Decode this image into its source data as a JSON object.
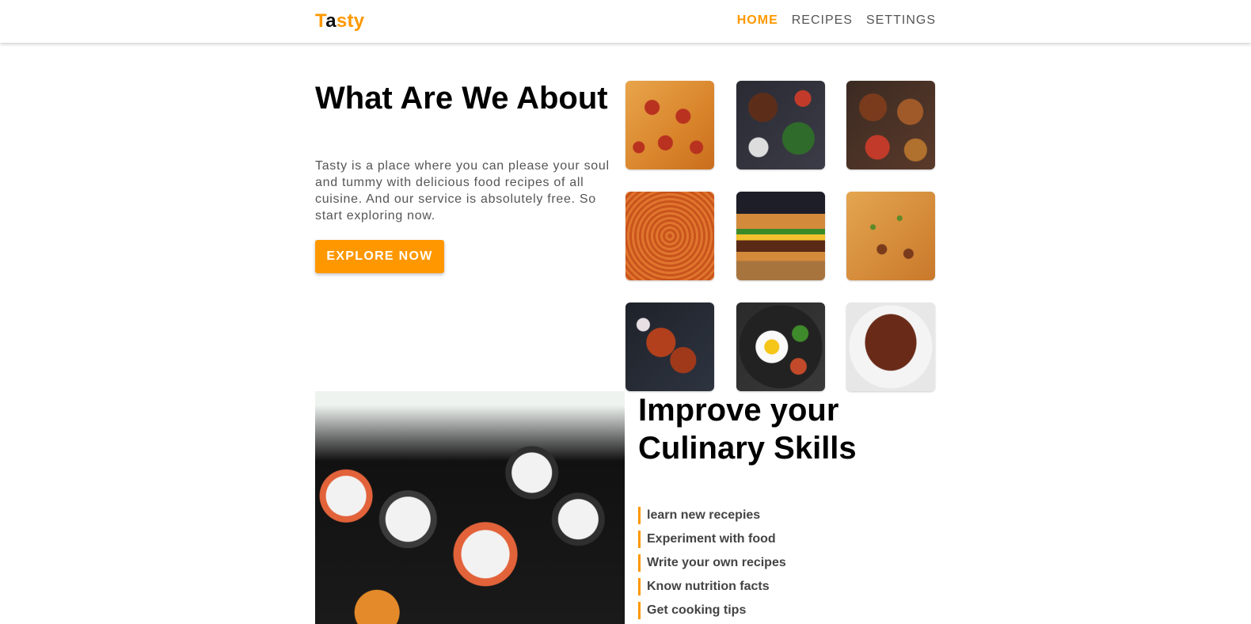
{
  "brand": {
    "logo_t": "T",
    "logo_a": "a",
    "logo_rest": "sty",
    "accent_color": "#ff9800"
  },
  "nav": {
    "items": [
      {
        "label": "HOME",
        "active": true
      },
      {
        "label": "RECIPES",
        "active": false
      },
      {
        "label": "SETTINGS",
        "active": false
      }
    ]
  },
  "about": {
    "title": "What Are We About",
    "text": "Tasty is a place where you can please your soul and tummy with delicious food recipes of all cuisine. And our service is absolutely free. So start exploring now.",
    "button_label": "EXPLORE NOW"
  },
  "gallery": {
    "tiles": [
      {
        "icon": "pizza-image"
      },
      {
        "icon": "bowl-image"
      },
      {
        "icon": "table-dishes-image"
      },
      {
        "icon": "spaghetti-image"
      },
      {
        "icon": "burger-image"
      },
      {
        "icon": "biryani-image"
      },
      {
        "icon": "chicken-image"
      },
      {
        "icon": "bibimbap-image"
      },
      {
        "icon": "steak-image"
      }
    ]
  },
  "skills": {
    "image_icon": "sushi-image",
    "title": "Improve your Culinary Skills",
    "items": [
      "learn new recepies",
      "Experiment with food",
      "Write your own recipes",
      "Know nutrition facts",
      "Get cooking tips"
    ]
  }
}
